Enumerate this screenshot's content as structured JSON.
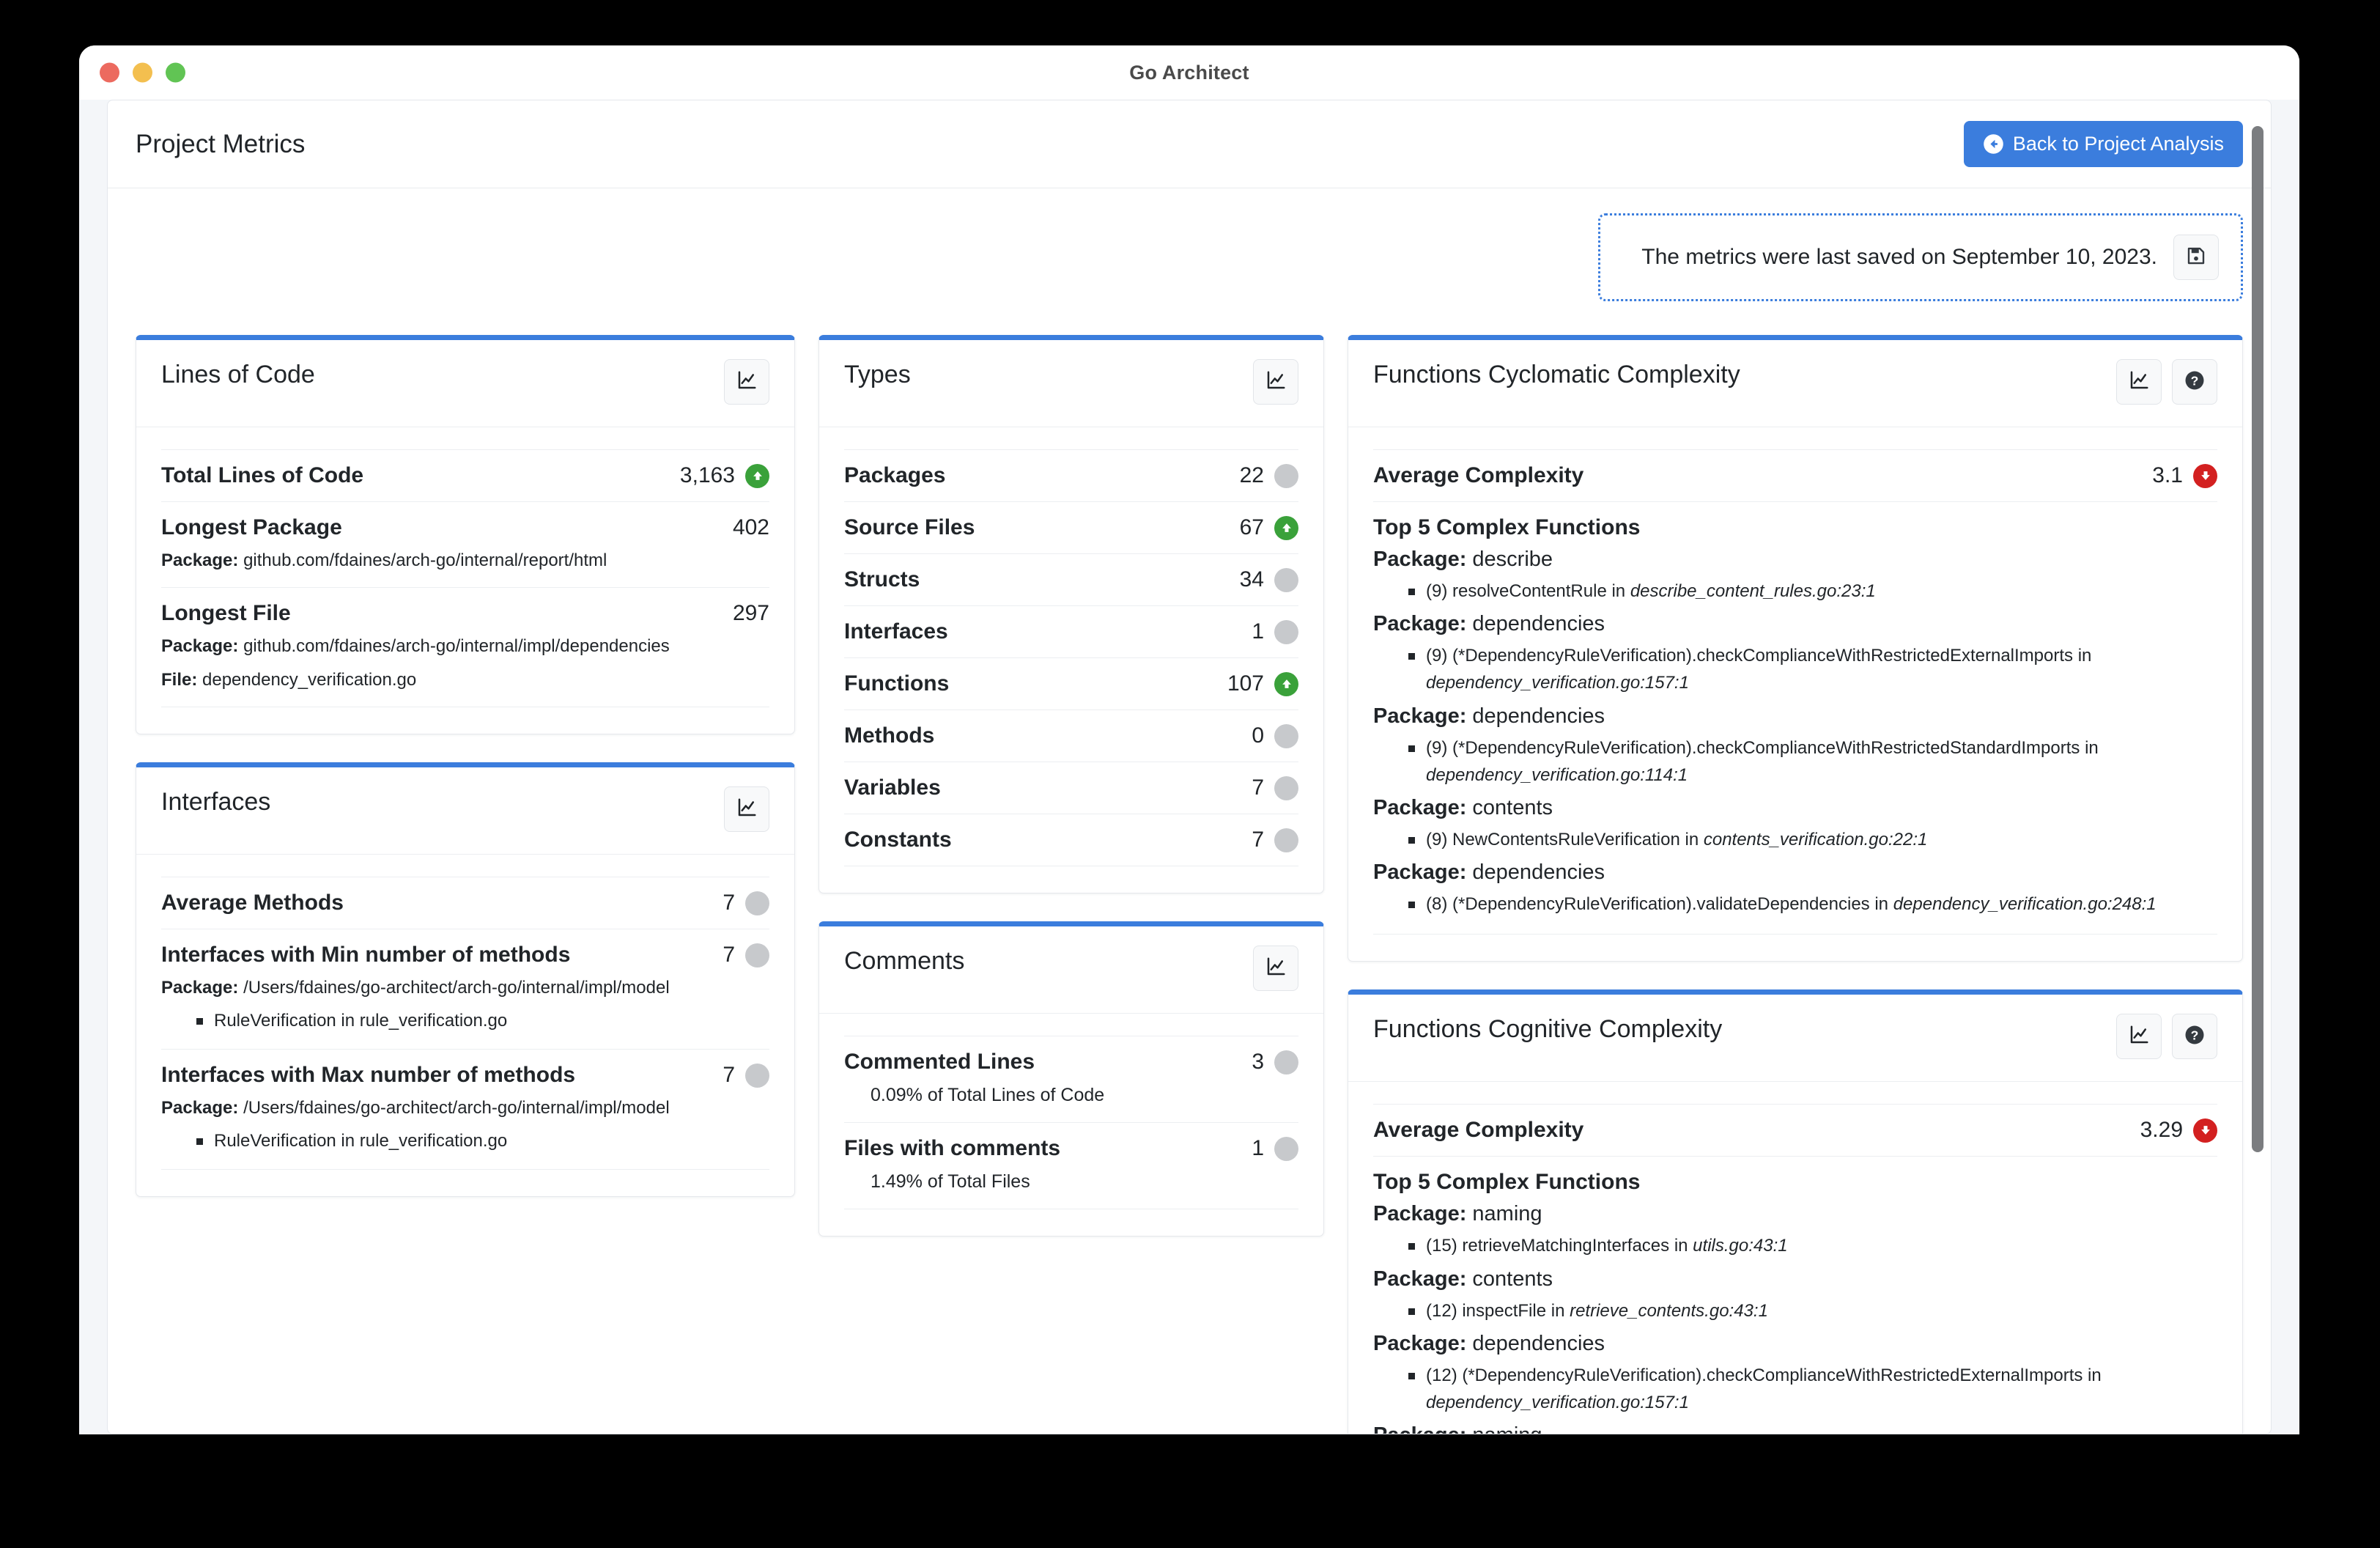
{
  "window": {
    "title": "Go Architect"
  },
  "header": {
    "title": "Project Metrics",
    "back_button": "Back to Project Analysis",
    "back_icon": "arrow-circle-left-icon"
  },
  "notice": {
    "text": "The metrics were last saved on September 10, 2023.",
    "save_icon": "floppy-disk-save-icon"
  },
  "icons": {
    "chart": "line-chart-icon",
    "help": "question-circle-icon"
  },
  "cards": {
    "lines_of_code": {
      "title": "Lines of Code",
      "rows": [
        {
          "label": "Total Lines of Code",
          "value": "3,163",
          "trend": "up"
        },
        {
          "label": "Longest Package",
          "value": "402",
          "trend": "none",
          "meta": [
            {
              "key": "Package:",
              "val": "github.com/fdaines/arch-go/internal/report/html"
            }
          ]
        },
        {
          "label": "Longest File",
          "value": "297",
          "trend": "none",
          "meta": [
            {
              "key": "Package:",
              "val": "github.com/fdaines/arch-go/internal/impl/dependencies"
            },
            {
              "key": "File:",
              "val": "dependency_verification.go"
            }
          ]
        }
      ]
    },
    "interfaces": {
      "title": "Interfaces",
      "rows": [
        {
          "label": "Average Methods",
          "value": "7",
          "trend": "flat"
        },
        {
          "label": "Interfaces with Min number of methods",
          "value": "7",
          "trend": "flat",
          "meta": [
            {
              "key": "Package:",
              "val": "/Users/fdaines/go-architect/arch-go/internal/impl/model"
            }
          ],
          "bullets": [
            "RuleVerification in rule_verification.go"
          ]
        },
        {
          "label": "Interfaces with Max number of methods",
          "value": "7",
          "trend": "flat",
          "meta": [
            {
              "key": "Package:",
              "val": "/Users/fdaines/go-architect/arch-go/internal/impl/model"
            }
          ],
          "bullets": [
            "RuleVerification in rule_verification.go"
          ]
        }
      ]
    },
    "types": {
      "title": "Types",
      "rows": [
        {
          "label": "Packages",
          "value": "22",
          "trend": "flat"
        },
        {
          "label": "Source Files",
          "value": "67",
          "trend": "up"
        },
        {
          "label": "Structs",
          "value": "34",
          "trend": "flat"
        },
        {
          "label": "Interfaces",
          "value": "1",
          "trend": "flat"
        },
        {
          "label": "Functions",
          "value": "107",
          "trend": "up"
        },
        {
          "label": "Methods",
          "value": "0",
          "trend": "flat"
        },
        {
          "label": "Variables",
          "value": "7",
          "trend": "flat"
        },
        {
          "label": "Constants",
          "value": "7",
          "trend": "flat"
        }
      ]
    },
    "comments": {
      "title": "Comments",
      "rows": [
        {
          "label": "Commented Lines",
          "value": "3",
          "trend": "flat",
          "note": "0.09% of Total Lines of Code"
        },
        {
          "label": "Files with comments",
          "value": "1",
          "trend": "flat",
          "note": "1.49% of Total Files"
        }
      ]
    },
    "cyclomatic": {
      "title": "Functions Cyclomatic Complexity",
      "average_label": "Average Complexity",
      "average_value": "3.1",
      "average_trend": "down",
      "section_title": "Top 5 Complex Functions",
      "groups": [
        {
          "pkg_key": "Package:",
          "pkg": "describe",
          "items": [
            {
              "text": "(9) resolveContentRule in ",
              "loc": "describe_content_rules.go:23:1"
            }
          ]
        },
        {
          "pkg_key": "Package:",
          "pkg": "dependencies",
          "items": [
            {
              "text": "(9) (*DependencyRuleVerification).checkComplianceWithRestrictedExternalImports in ",
              "loc": "dependency_verification.go:157:1"
            }
          ]
        },
        {
          "pkg_key": "Package:",
          "pkg": "dependencies",
          "items": [
            {
              "text": "(9) (*DependencyRuleVerification).checkComplianceWithRestrictedStandardImports in ",
              "loc": "dependency_verification.go:114:1"
            }
          ]
        },
        {
          "pkg_key": "Package:",
          "pkg": "contents",
          "items": [
            {
              "text": "(9) NewContentsRuleVerification in ",
              "loc": "contents_verification.go:22:1"
            }
          ]
        },
        {
          "pkg_key": "Package:",
          "pkg": "dependencies",
          "items": [
            {
              "text": "(8) (*DependencyRuleVerification).validateDependencies in ",
              "loc": "dependency_verification.go:248:1"
            }
          ]
        }
      ]
    },
    "cognitive": {
      "title": "Functions Cognitive Complexity",
      "average_label": "Average Complexity",
      "average_value": "3.29",
      "average_trend": "down",
      "section_title": "Top 5 Complex Functions",
      "groups": [
        {
          "pkg_key": "Package:",
          "pkg": "naming",
          "items": [
            {
              "text": "(15) retrieveMatchingInterfaces in ",
              "loc": "utils.go:43:1"
            }
          ]
        },
        {
          "pkg_key": "Package:",
          "pkg": "contents",
          "items": [
            {
              "text": "(12) inspectFile in ",
              "loc": "retrieve_contents.go:43:1"
            }
          ]
        },
        {
          "pkg_key": "Package:",
          "pkg": "dependencies",
          "items": [
            {
              "text": "(12) (*DependencyRuleVerification).checkComplianceWithRestrictedExternalImports in ",
              "loc": "dependency_verification.go:157:1"
            }
          ]
        },
        {
          "pkg_key": "Package:",
          "pkg": "naming",
          "items": []
        }
      ]
    }
  },
  "colors": {
    "accent": "#3b7ddd",
    "up": "#3aa13a",
    "down": "#d32020",
    "flat": "#c7c9cc"
  }
}
